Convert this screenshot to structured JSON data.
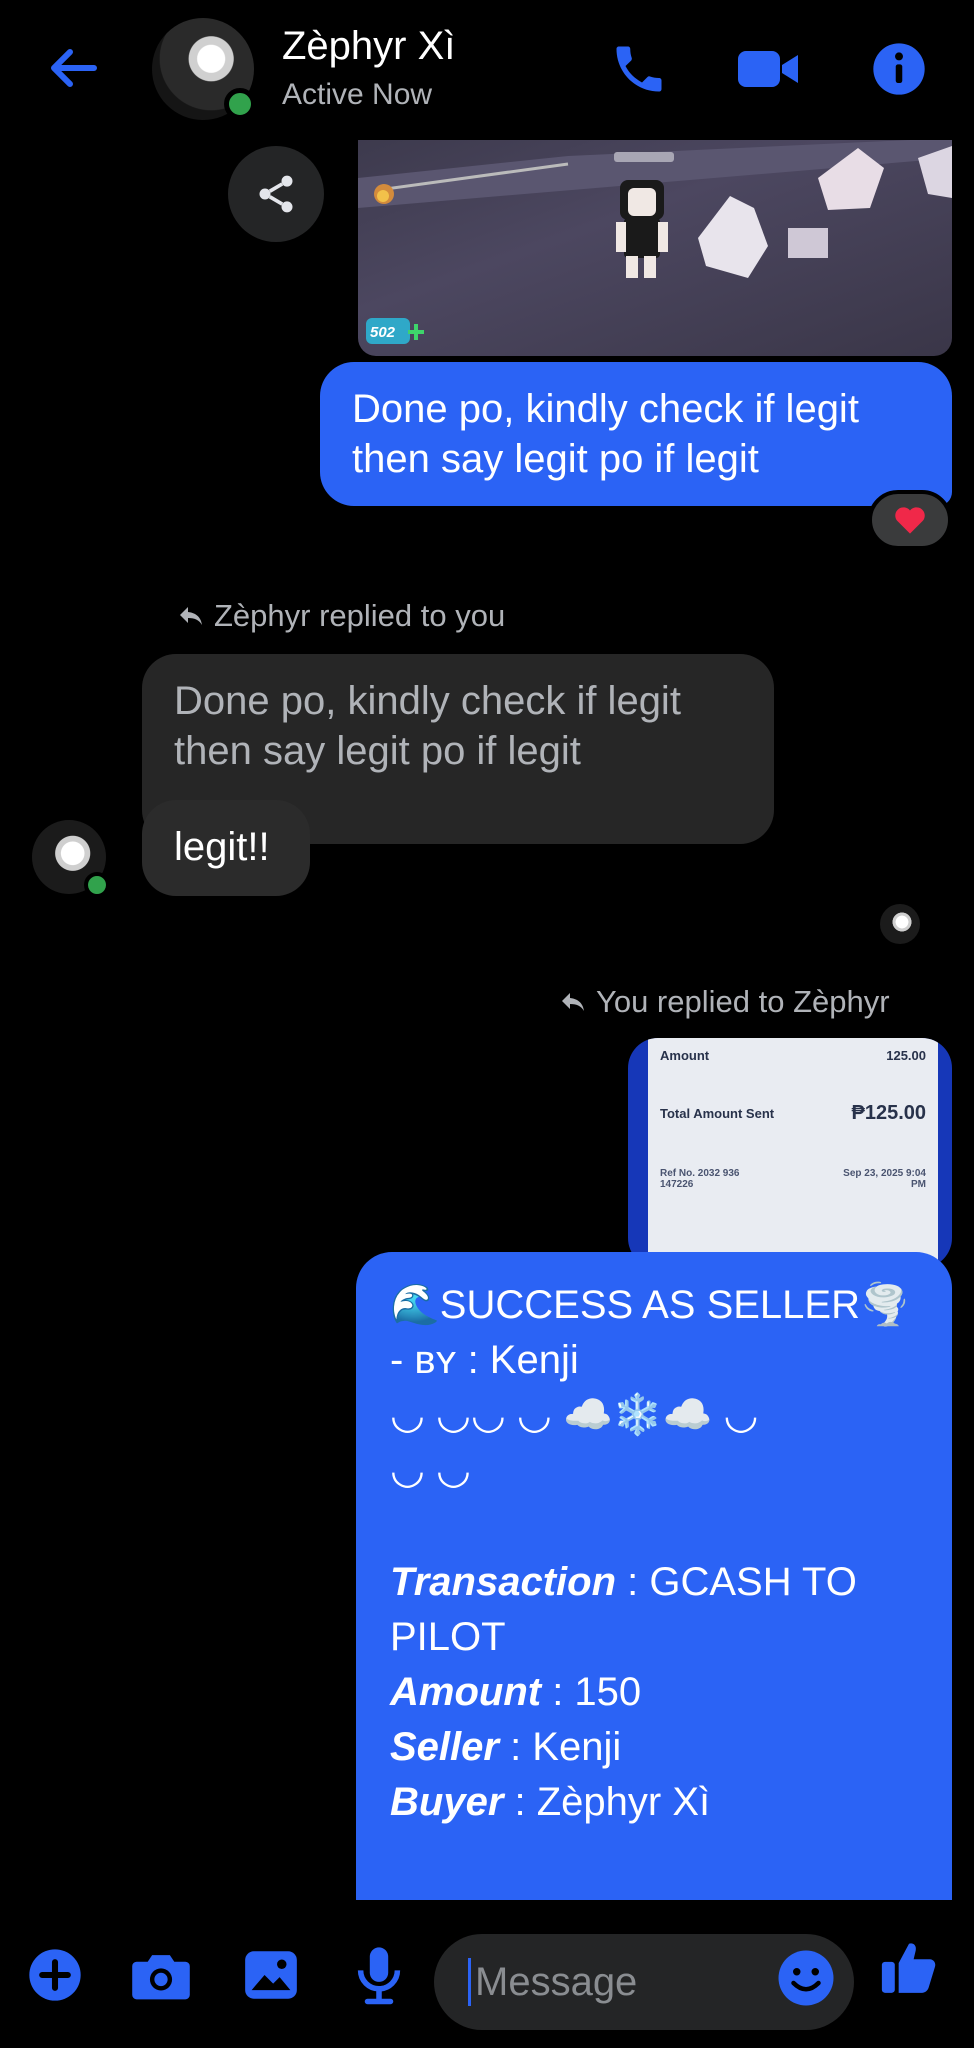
{
  "header": {
    "title": "Zèphyr Xì",
    "status": "Active Now",
    "accent": "#2b63f5"
  },
  "image_bubble": {
    "game_counter": "502"
  },
  "messages": {
    "outgoing_1": "Done po, kindly check if legit then say legit po if legit",
    "reaction": "❤️",
    "reply_label_in": "Zèphyr replied to you",
    "quoted_text": "Done po, kindly check if legit then say legit po if legit",
    "incoming_reply": "legit!!",
    "reply_label_out": "You replied to Zèphyr"
  },
  "receipt": {
    "amount_label": "Amount",
    "amount_value": "125.00",
    "total_label": "Total Amount Sent",
    "total_value": "₱125.00",
    "ref_label": "Ref No.",
    "ref_value": "2032 936 147226",
    "date_value": "Sep 23, 2025 9:04 PM"
  },
  "summary_message": {
    "heading": "🌊SUCCESS AS SELLER🌪️",
    "by_line": "- ʙʏ : Kenji",
    "decor_1": "◡ ◡◡ ◡ ☁️❄️☁️ ◡",
    "decor_2": "◡ ◡",
    "transaction_label": "Transaction",
    "transaction_value": " : GCASH TO PILOT",
    "amount_label": "Amount",
    "amount_value": " : 150",
    "seller_label": "Seller",
    "seller_value": " : Kenji",
    "buyer_label": "Buyer",
    "buyer_value": " : Zèphyr Xì"
  },
  "composer": {
    "placeholder": "Message"
  }
}
